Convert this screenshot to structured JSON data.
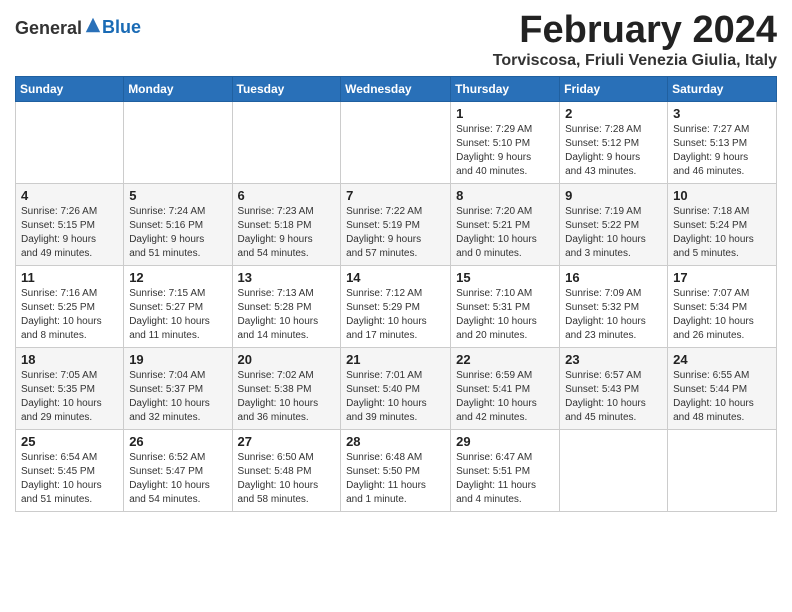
{
  "header": {
    "logo_general": "General",
    "logo_blue": "Blue",
    "month_title": "February 2024",
    "subtitle": "Torviscosa, Friuli Venezia Giulia, Italy"
  },
  "weekdays": [
    "Sunday",
    "Monday",
    "Tuesday",
    "Wednesday",
    "Thursday",
    "Friday",
    "Saturday"
  ],
  "weeks": [
    [
      {
        "day": "",
        "info": ""
      },
      {
        "day": "",
        "info": ""
      },
      {
        "day": "",
        "info": ""
      },
      {
        "day": "",
        "info": ""
      },
      {
        "day": "1",
        "info": "Sunrise: 7:29 AM\nSunset: 5:10 PM\nDaylight: 9 hours\nand 40 minutes."
      },
      {
        "day": "2",
        "info": "Sunrise: 7:28 AM\nSunset: 5:12 PM\nDaylight: 9 hours\nand 43 minutes."
      },
      {
        "day": "3",
        "info": "Sunrise: 7:27 AM\nSunset: 5:13 PM\nDaylight: 9 hours\nand 46 minutes."
      }
    ],
    [
      {
        "day": "4",
        "info": "Sunrise: 7:26 AM\nSunset: 5:15 PM\nDaylight: 9 hours\nand 49 minutes."
      },
      {
        "day": "5",
        "info": "Sunrise: 7:24 AM\nSunset: 5:16 PM\nDaylight: 9 hours\nand 51 minutes."
      },
      {
        "day": "6",
        "info": "Sunrise: 7:23 AM\nSunset: 5:18 PM\nDaylight: 9 hours\nand 54 minutes."
      },
      {
        "day": "7",
        "info": "Sunrise: 7:22 AM\nSunset: 5:19 PM\nDaylight: 9 hours\nand 57 minutes."
      },
      {
        "day": "8",
        "info": "Sunrise: 7:20 AM\nSunset: 5:21 PM\nDaylight: 10 hours\nand 0 minutes."
      },
      {
        "day": "9",
        "info": "Sunrise: 7:19 AM\nSunset: 5:22 PM\nDaylight: 10 hours\nand 3 minutes."
      },
      {
        "day": "10",
        "info": "Sunrise: 7:18 AM\nSunset: 5:24 PM\nDaylight: 10 hours\nand 5 minutes."
      }
    ],
    [
      {
        "day": "11",
        "info": "Sunrise: 7:16 AM\nSunset: 5:25 PM\nDaylight: 10 hours\nand 8 minutes."
      },
      {
        "day": "12",
        "info": "Sunrise: 7:15 AM\nSunset: 5:27 PM\nDaylight: 10 hours\nand 11 minutes."
      },
      {
        "day": "13",
        "info": "Sunrise: 7:13 AM\nSunset: 5:28 PM\nDaylight: 10 hours\nand 14 minutes."
      },
      {
        "day": "14",
        "info": "Sunrise: 7:12 AM\nSunset: 5:29 PM\nDaylight: 10 hours\nand 17 minutes."
      },
      {
        "day": "15",
        "info": "Sunrise: 7:10 AM\nSunset: 5:31 PM\nDaylight: 10 hours\nand 20 minutes."
      },
      {
        "day": "16",
        "info": "Sunrise: 7:09 AM\nSunset: 5:32 PM\nDaylight: 10 hours\nand 23 minutes."
      },
      {
        "day": "17",
        "info": "Sunrise: 7:07 AM\nSunset: 5:34 PM\nDaylight: 10 hours\nand 26 minutes."
      }
    ],
    [
      {
        "day": "18",
        "info": "Sunrise: 7:05 AM\nSunset: 5:35 PM\nDaylight: 10 hours\nand 29 minutes."
      },
      {
        "day": "19",
        "info": "Sunrise: 7:04 AM\nSunset: 5:37 PM\nDaylight: 10 hours\nand 32 minutes."
      },
      {
        "day": "20",
        "info": "Sunrise: 7:02 AM\nSunset: 5:38 PM\nDaylight: 10 hours\nand 36 minutes."
      },
      {
        "day": "21",
        "info": "Sunrise: 7:01 AM\nSunset: 5:40 PM\nDaylight: 10 hours\nand 39 minutes."
      },
      {
        "day": "22",
        "info": "Sunrise: 6:59 AM\nSunset: 5:41 PM\nDaylight: 10 hours\nand 42 minutes."
      },
      {
        "day": "23",
        "info": "Sunrise: 6:57 AM\nSunset: 5:43 PM\nDaylight: 10 hours\nand 45 minutes."
      },
      {
        "day": "24",
        "info": "Sunrise: 6:55 AM\nSunset: 5:44 PM\nDaylight: 10 hours\nand 48 minutes."
      }
    ],
    [
      {
        "day": "25",
        "info": "Sunrise: 6:54 AM\nSunset: 5:45 PM\nDaylight: 10 hours\nand 51 minutes."
      },
      {
        "day": "26",
        "info": "Sunrise: 6:52 AM\nSunset: 5:47 PM\nDaylight: 10 hours\nand 54 minutes."
      },
      {
        "day": "27",
        "info": "Sunrise: 6:50 AM\nSunset: 5:48 PM\nDaylight: 10 hours\nand 58 minutes."
      },
      {
        "day": "28",
        "info": "Sunrise: 6:48 AM\nSunset: 5:50 PM\nDaylight: 11 hours\nand 1 minute."
      },
      {
        "day": "29",
        "info": "Sunrise: 6:47 AM\nSunset: 5:51 PM\nDaylight: 11 hours\nand 4 minutes."
      },
      {
        "day": "",
        "info": ""
      },
      {
        "day": "",
        "info": ""
      }
    ]
  ]
}
